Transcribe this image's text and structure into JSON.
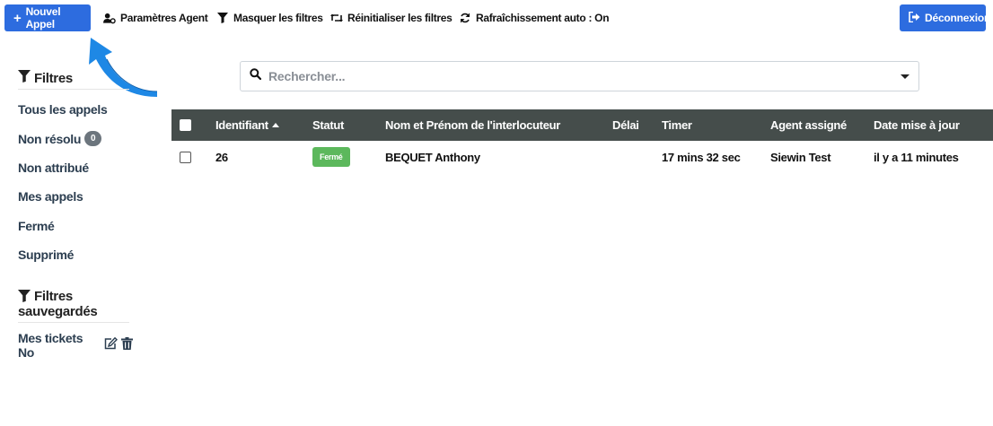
{
  "toolbar": {
    "new_call": "Nouvel Appel",
    "agent_settings": "Paramètres Agent",
    "hide_filters": "Masquer les filtres",
    "reset_filters": "Réinitialiser les filtres",
    "auto_refresh": "Rafraîchissement auto : On",
    "logout": "Déconnexion"
  },
  "sidebar": {
    "filters_title": "Filtres",
    "items": [
      {
        "label": "Tous les appels"
      },
      {
        "label": "Non résolu",
        "badge": "0"
      },
      {
        "label": "Non attribué"
      },
      {
        "label": "Mes appels"
      },
      {
        "label": "Fermé"
      },
      {
        "label": "Supprimé"
      }
    ],
    "saved_title_1": "Filtres",
    "saved_title_2": "sauvegardés",
    "saved_items": [
      {
        "label": "Mes tickets No"
      }
    ]
  },
  "search": {
    "placeholder": "Rechercher..."
  },
  "table": {
    "columns": [
      "Identifiant",
      "Statut",
      "Nom et Prénom de l'interlocuteur",
      "Délai",
      "Timer",
      "Agent assigné",
      "Date mise à jour"
    ],
    "rows": [
      {
        "id": "26",
        "status": "Fermé",
        "name": "BEQUET Anthony",
        "delay": "",
        "timer": "17 mins 32 sec",
        "agent": "Siewin Test",
        "updated": "il y a 11 minutes"
      }
    ]
  },
  "colors": {
    "primary": "#2d6cdf",
    "header_bg": "#454d4b",
    "status_closed": "#5cb85c",
    "arrow": "#1e88e5"
  }
}
